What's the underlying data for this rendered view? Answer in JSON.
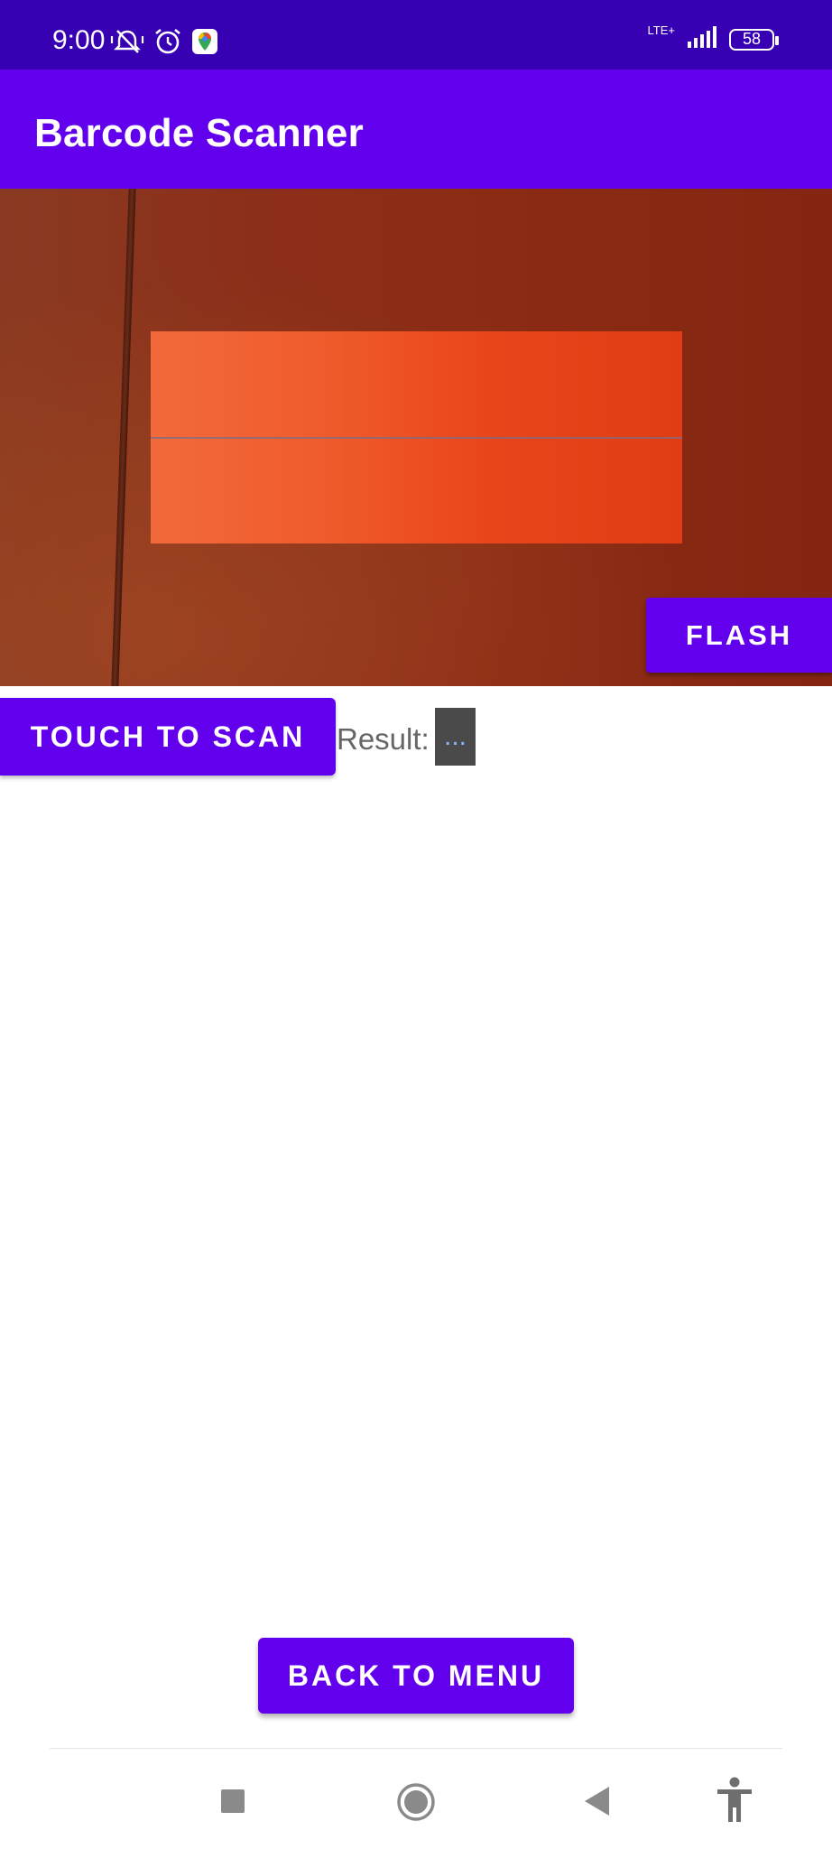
{
  "status_bar": {
    "time": "9:00",
    "network": "LTE+",
    "battery": "58",
    "icons": [
      "mute-notifications-icon",
      "alarm-icon",
      "maps-icon",
      "signal-icon",
      "battery-icon"
    ]
  },
  "app_bar": {
    "title": "Barcode Scanner"
  },
  "camera": {
    "flash_label": "FLASH"
  },
  "scan": {
    "button_label": "TOUCH TO SCAN",
    "result_label": "Result:",
    "result_value": "..."
  },
  "footer": {
    "back_label": "BACK TO MENU"
  },
  "nav_bar": {
    "icons": [
      "recents-square-icon",
      "home-circle-icon",
      "back-triangle-icon",
      "accessibility-icon"
    ]
  },
  "colors": {
    "primary": "#6200ee",
    "status_bar": "#3700b3"
  }
}
